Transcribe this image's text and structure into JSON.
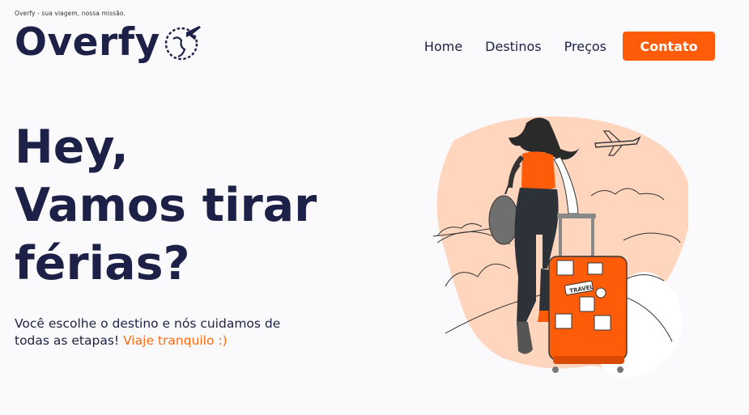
{
  "header": {
    "tagline": "Overfy - sua viagem, nossa missão.",
    "logo_text": "Overfy",
    "logo_icon": "globe-plane-icon"
  },
  "nav": {
    "links": [
      "Home",
      "Destinos",
      "Preços"
    ],
    "cta_label": "Contato"
  },
  "hero": {
    "title_lines": [
      "Hey,",
      "Vamos tirar",
      "férias?"
    ],
    "subtitle": "Você escolhe o destino e nós cuidamos de todas as etapas!",
    "subtitle_accent": "Viaje tranquilo :)"
  },
  "illustration": {
    "name": "traveler-with-suitcase-illustration",
    "suitcase_stickers": [
      "TRAVEL"
    ]
  },
  "colors": {
    "primary": "#1d2147",
    "accent": "#ff5c0a",
    "background": "#faf9fb",
    "blob": "#ffd5bd"
  }
}
